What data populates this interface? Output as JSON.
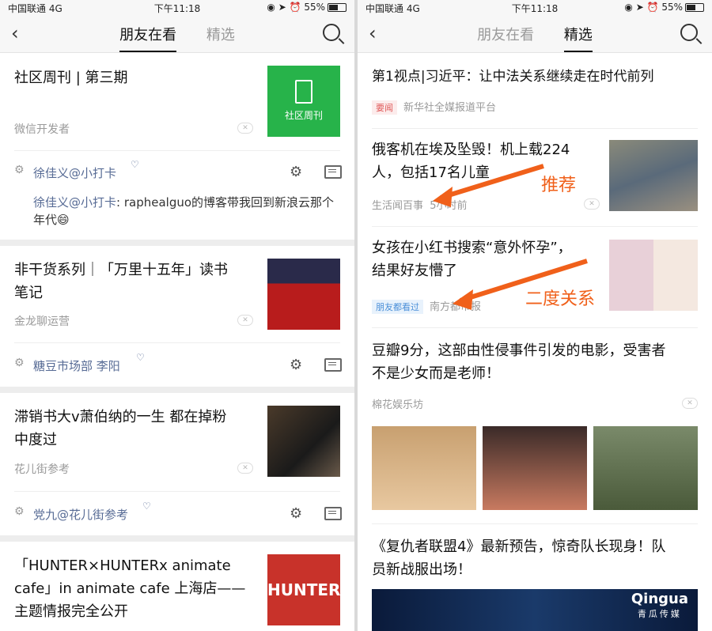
{
  "status": {
    "carrier": "中国联通  4G",
    "time": "下午11:18",
    "battery": "55%"
  },
  "left": {
    "tabs": [
      "朋友在看",
      "精选"
    ],
    "cards": [
      {
        "title": "社区周刊 | 第三期",
        "source": "微信开发者",
        "thumb_text": "社区周刊",
        "friend": "徐佳义@小打卡",
        "comment_author": "徐佳义@小打卡",
        "comment": ": raphealguo的博客带我回到新浪云那个年代😄"
      },
      {
        "title_line1": "非干货系列｜「万里十五年」读书",
        "title_line2": "笔记",
        "source": "金龙聊运营",
        "friend": "糖豆市场部 李阳"
      },
      {
        "title_line1": "滞销书大v萧伯纳的一生 都在掉粉",
        "title_line2": "中度过",
        "source": "花儿街参考",
        "friend": "党九@花儿街参考"
      },
      {
        "title_line1": "「HUNTER×HUNTERx animate",
        "title_line2": "cafe」in animate cafe 上海店——",
        "title_line3": "主题情报完全公开",
        "thumb_text": "HUNTER"
      }
    ]
  },
  "right": {
    "tabs": [
      "朋友在看",
      "精选"
    ],
    "items": [
      {
        "title": "第1视点|习近平：让中法关系继续走在时代前列",
        "tag": "要闻",
        "source": "新华社全媒报道平台"
      },
      {
        "title_line1": "俄客机在埃及坠毁！机上载224",
        "title_line2": "人，包括17名儿童",
        "source": "生活闻百事",
        "time": "5小时前"
      },
      {
        "title_line1": "女孩在小红书搜索“意外怀孕”，",
        "title_line2": "结果好友懵了",
        "tag": "朋友都看过",
        "source": "南方都市报"
      },
      {
        "title_line1": "豆瓣9分，这部由性侵事件引发的电影，受害者",
        "title_line2": "不是少女而是老师！",
        "source": "棉花娱乐坊"
      },
      {
        "title_line1": "《复仇者联盟4》最新预告，惊奇队长现身！队",
        "title_line2": "员新战服出场！"
      }
    ],
    "annotations": {
      "recommend": "推荐",
      "second_degree": "二度关系"
    },
    "watermark": {
      "brand": "Qingua",
      "sub": "青瓜传媒"
    }
  },
  "colors": {
    "accent_link": "#576b95",
    "arrow": "#f0601a",
    "green_thumb": "#27b34a"
  }
}
